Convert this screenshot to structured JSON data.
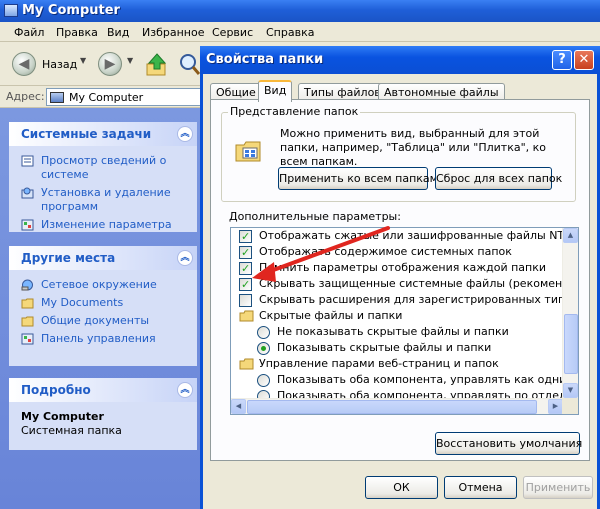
{
  "explorer": {
    "title": "My Computer",
    "menu": [
      "Файл",
      "Правка",
      "Вид",
      "Избранное",
      "Сервис",
      "Справка"
    ],
    "toolbar": {
      "back_label": "Назад"
    },
    "address": {
      "label": "Адрес:",
      "value": "My Computer"
    },
    "panels": {
      "system_tasks": {
        "title": "Системные задачи",
        "items": [
          "Просмотр сведений о системе",
          "Установка и удаление",
          "программ",
          "Изменение параметра"
        ]
      },
      "other_places": {
        "title": "Другие места",
        "items": [
          "Сетевое окружение",
          "My Documents",
          "Общие документы",
          "Панель управления"
        ]
      },
      "details": {
        "title": "Подробно",
        "name": "My Computer",
        "subtitle": "Системная папка"
      }
    }
  },
  "dialog": {
    "title": "Свойства папки",
    "tabs": [
      "Общие",
      "Вид",
      "Типы файлов",
      "Автономные файлы"
    ],
    "active_tab": "Вид",
    "folder_view": {
      "legend": "Представление папок",
      "description": "Можно применить вид, выбранный для этой папки, например, \"Таблица\" или \"Плитка\", ко всем папкам.",
      "apply_all": "Применить ко всем папкам",
      "reset_all": "Сброс для всех папок"
    },
    "advanced_label": "Дополнительные параметры:",
    "tree": [
      {
        "kind": "checkbox",
        "checked": true,
        "indent": 1,
        "label": "Отображать сжатые или зашифрованные файлы NTFS други"
      },
      {
        "kind": "checkbox",
        "checked": true,
        "indent": 1,
        "label": "Отображать содержимое системных папок"
      },
      {
        "kind": "checkbox",
        "checked": true,
        "indent": 1,
        "label": "Помнить параметры отображения каждой папки"
      },
      {
        "kind": "checkbox",
        "checked": true,
        "indent": 1,
        "label": "Скрывать защищенные системные файлы (рекомендуется)"
      },
      {
        "kind": "checkbox",
        "checked": false,
        "indent": 1,
        "label": "Скрывать расширения для зарегистрированных типов файло"
      },
      {
        "kind": "folder",
        "indent": 1,
        "label": "Скрытые файлы и папки"
      },
      {
        "kind": "radio",
        "checked": false,
        "indent": 2,
        "label": "Не показывать скрытые файлы и папки"
      },
      {
        "kind": "radio",
        "checked": true,
        "indent": 2,
        "label": "Показывать скрытые файлы и папки"
      },
      {
        "kind": "folder",
        "indent": 1,
        "label": "Управление парами веб-страниц и папок"
      },
      {
        "kind": "radio",
        "checked": false,
        "indent": 2,
        "label": "Показывать оба компонента, управлять как одним фай"
      },
      {
        "kind": "radio",
        "checked": false,
        "indent": 2,
        "label": "Показывать оба компонента, управлять по отдельности"
      }
    ],
    "restore_defaults": "Восстановить умолчания",
    "ok": "ОК",
    "cancel": "Отмена",
    "apply": "Применить"
  },
  "colors": {
    "xp_blue": "#0a52d6",
    "task_link": "#215dc6",
    "check_green": "#21a121",
    "annotation_arrow": "#e0261f"
  }
}
